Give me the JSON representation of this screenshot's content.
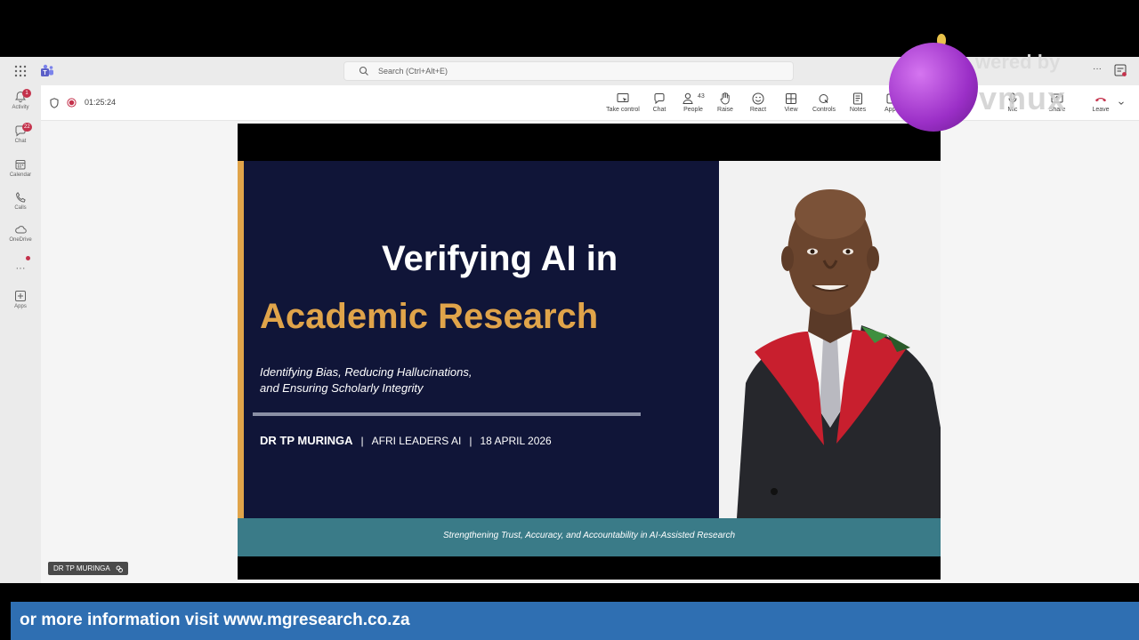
{
  "topbar": {
    "search_placeholder": "Search (Ctrl+Alt+E)"
  },
  "rail": {
    "items": [
      {
        "label": "Activity",
        "badge": "1"
      },
      {
        "label": "Chat",
        "badge": "22"
      },
      {
        "label": "Calendar"
      },
      {
        "label": "Calls"
      },
      {
        "label": "OneDrive"
      },
      {
        "label": "Apps"
      }
    ]
  },
  "meeting": {
    "timer": "01:25:24",
    "toolbar": {
      "take_control": "Take control",
      "chat": "Chat",
      "people": "People",
      "people_count": "43",
      "raise": "Raise",
      "react": "React",
      "view": "View",
      "controls": "Controls",
      "notes": "Notes",
      "apps": "Apps",
      "mic": "Mic",
      "share": "Share",
      "leave": "Leave"
    }
  },
  "slide": {
    "title_line1": "Verifying AI in",
    "title_line2": "Academic Research",
    "subtitle_line1": "Identifying Bias, Reducing Hallucinations,",
    "subtitle_line2": "and Ensuring Scholarly Integrity",
    "presenter": "DR TP MURINGA",
    "sep": "|",
    "org": "AFRI LEADERS AI",
    "date": "18 APRIL 2026",
    "tagline": "Strengthening Trust, Accuracy, and Accountability in AI-Assisted Research"
  },
  "speaker_tag": "DR TP MURINGA",
  "watermark": {
    "line1": "wered by",
    "line2": "vmux"
  },
  "banner": {
    "text": "or more information visit www.mgresearch.co.za"
  },
  "colors": {
    "slide_bg": "#101538",
    "accent_gold": "#e0a44a",
    "tagline_band": "#3a7b88",
    "banner_blue": "#2f6fb2",
    "leave_red": "#c4314b"
  }
}
